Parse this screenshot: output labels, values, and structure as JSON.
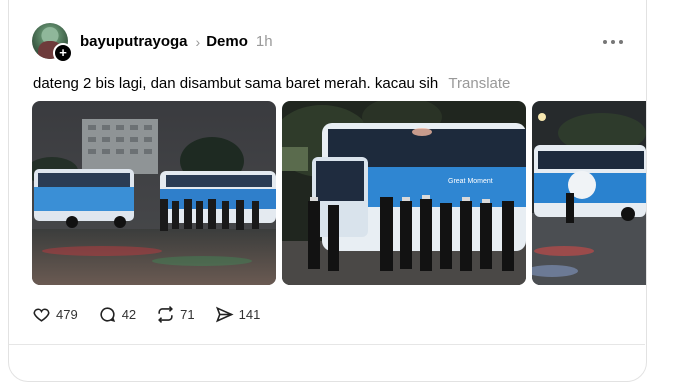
{
  "post": {
    "username": "bayuputrayoga",
    "topic": "Demo",
    "time": "1h",
    "text": "dateng 2 bis lagi, dan disambut sama baret merah. kacau sih",
    "translate_label": "Translate",
    "bus_caption": "Great Moment"
  },
  "actions": {
    "likes": "479",
    "comments": "42",
    "reposts": "71",
    "shares": "141"
  },
  "icons": [
    "add-icon",
    "chevron-right-icon",
    "more-icon",
    "heart-icon",
    "comment-icon",
    "repost-icon",
    "share-icon"
  ],
  "colors": {
    "secondary_text": "#999999",
    "bus_blue": "#3a8fd6"
  }
}
